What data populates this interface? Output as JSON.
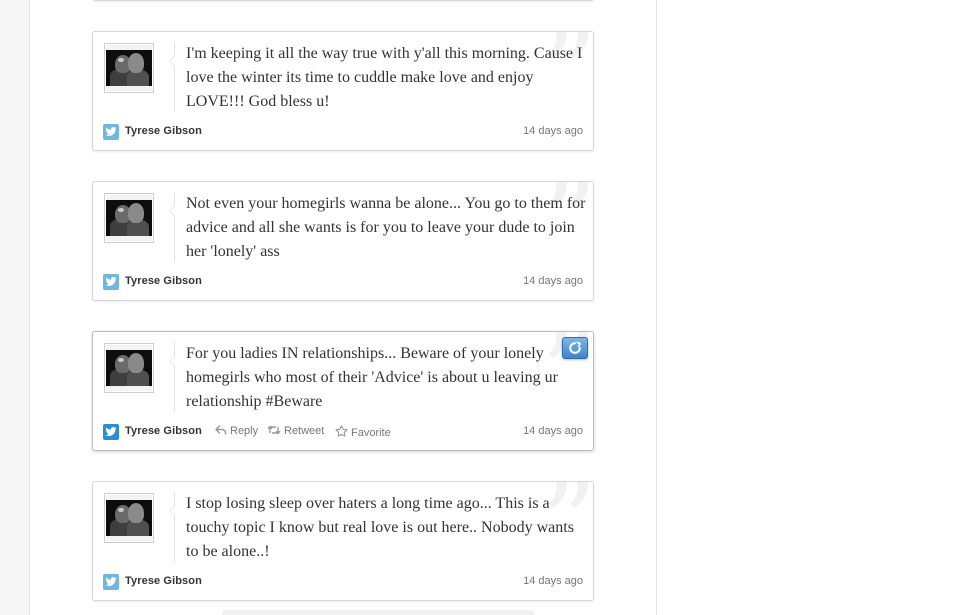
{
  "tweets": [
    {
      "text": "I'm keeping it all the way true with y'all this morning. Cause I love the winter its time to cuddle make love and enjoy LOVE!!! God bless u!",
      "author": "Tyrese Gibson",
      "time": "14 days ago"
    },
    {
      "text": "Not even your homegirls wanna be alone... You go to them for advice and all she wants is for you to leave your dude to join her 'lonely' ass",
      "author": "Tyrese Gibson",
      "time": "14 days ago"
    },
    {
      "text": "For you ladies IN relationships... Beware of your lonely homegirls who most of their 'Advice' is about u leaving ur relationship #Beware",
      "author": "Tyrese Gibson",
      "time": "14 days ago",
      "actions": {
        "reply": "Reply",
        "retweet": "Retweet",
        "favorite": "Favorite"
      }
    },
    {
      "text": "I stop losing sleep over haters a long time ago... This is a touchy topic I know but real love is out here.. Nobody wants to be alone..!",
      "author": "Tyrese Gibson",
      "time": "14 days ago"
    }
  ],
  "icons": {
    "source": "twitter-bird-icon",
    "share": "share-icon",
    "reply": "reply-arrow-icon",
    "retweet": "retweet-icon",
    "favorite": "star-icon",
    "quote": "quote-mark-icon"
  },
  "colors": {
    "twitter_blue": "#2b8ed1",
    "twitter_blue_muted": "#6fb6e0",
    "share_button": "#3e85c6",
    "text": "#333333",
    "meta": "#777777"
  }
}
